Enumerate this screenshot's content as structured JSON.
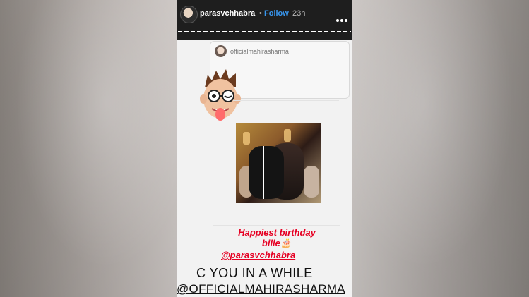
{
  "header": {
    "username": "parasvchhabra",
    "separator": "•",
    "follow_label": "Follow",
    "time": "23h",
    "more_icon": "more-horizontal-icon"
  },
  "story": {
    "card_username": "officialmahirasharma",
    "birthday_lines": [
      "Happiest birthday",
      "bille🎂"
    ],
    "mention": "@parasvchhabra",
    "caption_line1": "C YOU IN A WHILE",
    "caption_line2": "@OFFICIALMAHIRASHARMA"
  },
  "colors": {
    "accent_follow": "#3897f0",
    "birthday_text": "#e60023",
    "topbar_bg": "#1e1e1e"
  }
}
